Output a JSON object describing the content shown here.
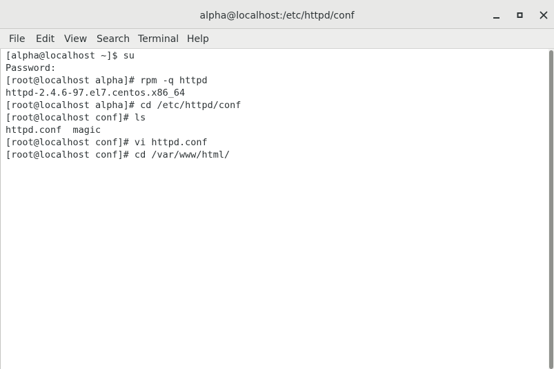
{
  "window": {
    "title": "alpha@localhost:/etc/httpd/conf",
    "controls": {
      "minimize_icon": "minimize-icon",
      "maximize_icon": "maximize-icon",
      "close_icon": "close-icon"
    }
  },
  "menubar": {
    "items": [
      "File",
      "Edit",
      "View",
      "Search",
      "Terminal",
      "Help"
    ]
  },
  "terminal": {
    "lines": [
      "[alpha@localhost ~]$ su",
      "Password:",
      "[root@localhost alpha]# rpm -q httpd",
      "httpd-2.4.6-97.el7.centos.x86_64",
      "[root@localhost alpha]# cd /etc/httpd/conf",
      "[root@localhost conf]# ls",
      "httpd.conf  magic",
      "[root@localhost conf]# vi httpd.conf",
      "[root@localhost conf]# cd /var/www/html/"
    ]
  },
  "colors": {
    "titlebar_bg": "#e8e8e7",
    "menubar_bg": "#ededec",
    "text": "#2e3436",
    "terminal_bg": "#ffffff",
    "scroll_thumb": "#8f918d"
  }
}
